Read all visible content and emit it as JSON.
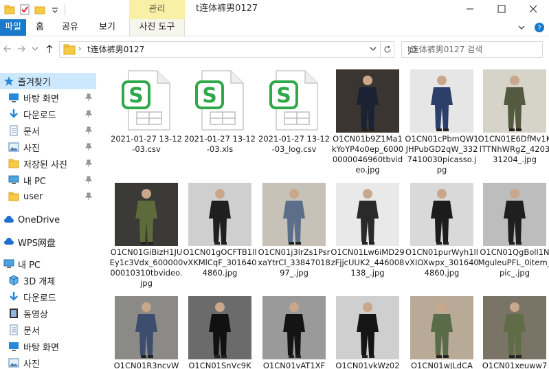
{
  "titlebar": {
    "context_group": "관리",
    "title": "t连体裤男0127"
  },
  "ribbon": {
    "tabs": [
      "파일",
      "홈",
      "공유",
      "보기",
      "사진 도구"
    ]
  },
  "address": {
    "path": "t连体裤男0127",
    "search_placeholder": "t连体裤男0127 검색"
  },
  "sidebar": {
    "items": [
      {
        "label": "즐겨찾기",
        "icon": "star-icon",
        "pinned": false
      },
      {
        "label": "바탕 화면",
        "icon": "desktop-icon",
        "pinned": true
      },
      {
        "label": "다운로드",
        "icon": "download-icon",
        "pinned": true
      },
      {
        "label": "문서",
        "icon": "document-icon",
        "pinned": true
      },
      {
        "label": "사진",
        "icon": "pictures-icon",
        "pinned": true
      },
      {
        "label": "저장된 사진",
        "icon": "folder-icon",
        "pinned": true
      },
      {
        "label": "내 PC",
        "icon": "pc-icon",
        "pinned": true
      },
      {
        "label": "user",
        "icon": "folder-icon",
        "pinned": true
      },
      {
        "label": "OneDrive",
        "icon": "cloud-icon",
        "pinned": false
      },
      {
        "label": "WPS网盘",
        "icon": "cloud-icon",
        "pinned": false
      },
      {
        "label": "내 PC",
        "icon": "pc-icon",
        "pinned": false
      },
      {
        "label": "3D 개체",
        "icon": "cube-icon",
        "pinned": false
      },
      {
        "label": "다운로드",
        "icon": "download-icon",
        "pinned": false
      },
      {
        "label": "동영상",
        "icon": "video-icon",
        "pinned": false
      },
      {
        "label": "문서",
        "icon": "document-icon",
        "pinned": false
      },
      {
        "label": "바탕 화면",
        "icon": "desktop-icon",
        "pinned": false
      },
      {
        "label": "사진",
        "icon": "pictures-icon",
        "pinned": false
      }
    ]
  },
  "files": [
    {
      "name": "2021-01-27 13-12-03.csv",
      "kind": "wps-sheet",
      "bg": "#ffffff",
      "fg": "#000000"
    },
    {
      "name": "2021-01-27 13-12-03.xls",
      "kind": "wps-sheet",
      "bg": "#ffffff",
      "fg": "#000000"
    },
    {
      "name": "2021-01-27 13-12-03_log.csv",
      "kind": "wps-sheet",
      "bg": "#ffffff",
      "fg": "#000000"
    },
    {
      "name": "O1CN01b9Z1Ma1kYoYP4o0ep_60000000046960tbvideo.jpg",
      "kind": "photo",
      "bg": "#3a3530",
      "fg": "#1b2233"
    },
    {
      "name": "O1CN01cPbmQW1JHPubGD2qW_3327410030picasso.jpg",
      "kind": "photo",
      "bg": "#e6e6e6",
      "fg": "#2c3f6b"
    },
    {
      "name": "O1CN01E6DfMv1KlTTNhWRgZ_420331204_.jpg",
      "kind": "photo",
      "bg": "#d6d3c9",
      "fg": "#545a40"
    },
    {
      "name": "O1CN01GiBizH1JUEy1c3Vdx_60000000010310tbvideo.jpg",
      "kind": "photo",
      "bg": "#3b3a36",
      "fg": "#5d6a3a"
    },
    {
      "name": "O1CN01gOCFTB1llvXKMlCqF_3016404860.jpg",
      "kind": "photo",
      "bg": "#cfcfcf",
      "fg": "#1f1f1f"
    },
    {
      "name": "O1CN01j3lrZs1PsrxaYtrCl_3384701897_.jpg",
      "kind": "photo",
      "bg": "#c7c2b8",
      "fg": "#5c6f8a"
    },
    {
      "name": "O1CN01Lw6iMD29zFjjcUUK2_446008138_.jpg",
      "kind": "photo",
      "bg": "#e9e9e9",
      "fg": "#2a2a2a"
    },
    {
      "name": "O1CN01purWyh1llvXIOXwpx_3016404860.jpg",
      "kind": "photo",
      "bg": "#d9d9d9",
      "fg": "#1c1c1c"
    },
    {
      "name": "O1CN01QgBoll1NMguleuPFL_0item_pic_.jpg",
      "kind": "photo",
      "bg": "#bdbdbd",
      "fg": "#1f1f1f"
    },
    {
      "name": "O1CN01R3ncvW",
      "kind": "photo",
      "bg": "#8c8a86",
      "fg": "#3d4d6e"
    },
    {
      "name": "O1CN01SnVc9K",
      "kind": "photo",
      "bg": "#6b6b6b",
      "fg": "#111111"
    },
    {
      "name": "O1CN01vAT1XF",
      "kind": "photo",
      "bg": "#9a9a9a",
      "fg": "#141414"
    },
    {
      "name": "O1CN01vkWz02",
      "kind": "photo",
      "bg": "#cfcfcf",
      "fg": "#151515"
    },
    {
      "name": "O1CN01wJLdCA",
      "kind": "photo",
      "bg": "#b8aa96",
      "fg": "#5a6b4a"
    },
    {
      "name": "O1CN01xeuww7",
      "kind": "photo",
      "bg": "#7a7466",
      "fg": "#5f6c47"
    }
  ],
  "colors": {
    "file_tab": "#1979ca",
    "selected_nav": "#cce8ff",
    "context_tab": "#f8f0a6",
    "wps_green": "#2fa84a"
  }
}
